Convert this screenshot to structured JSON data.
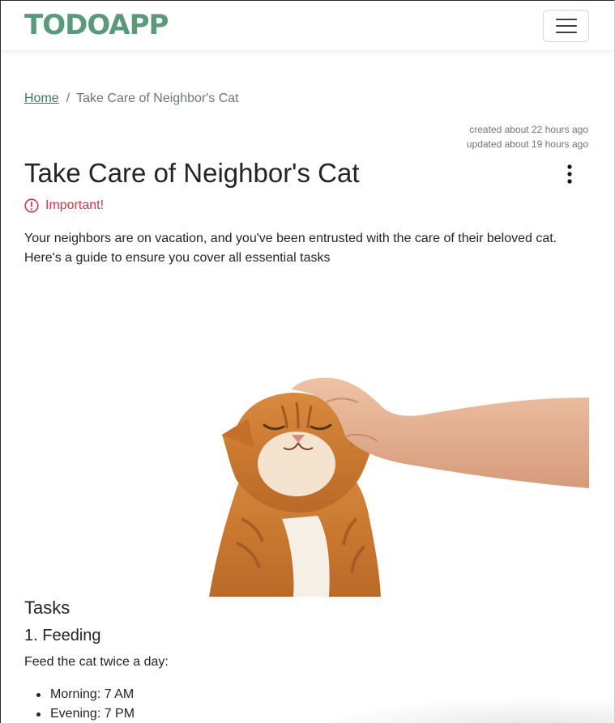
{
  "app": {
    "brand": "TODOAPP",
    "brand_color": "#5a9a7a",
    "menu_icon": "hamburger-menu-icon"
  },
  "breadcrumb": {
    "home_label": "Home",
    "separator": "/",
    "current": "Take Care of Neighbor's Cat",
    "link_color": "#3b7a57"
  },
  "meta": {
    "created": "created about 22 hours ago",
    "updated": "updated about 19 hours ago"
  },
  "todo": {
    "title": "Take Care of Neighbor's Cat",
    "options_icon": "vertical-ellipsis-icon",
    "important_label": "Important!",
    "important_icon": "exclamation-circle-icon",
    "important_color": "#dc3545",
    "description": "Your neighbors are on vacation, and you've been entrusted with the care of their beloved cat. Here's a guide to ensure you cover all essential tasks",
    "image_subject": "orange tabby cat being petted by hand"
  },
  "tasks": {
    "heading": "Tasks",
    "sections": [
      {
        "heading": "1. Feeding",
        "intro": "Feed the cat twice a day:",
        "items": [
          "Morning: 7 AM",
          "Evening: 7 PM"
        ]
      }
    ]
  }
}
